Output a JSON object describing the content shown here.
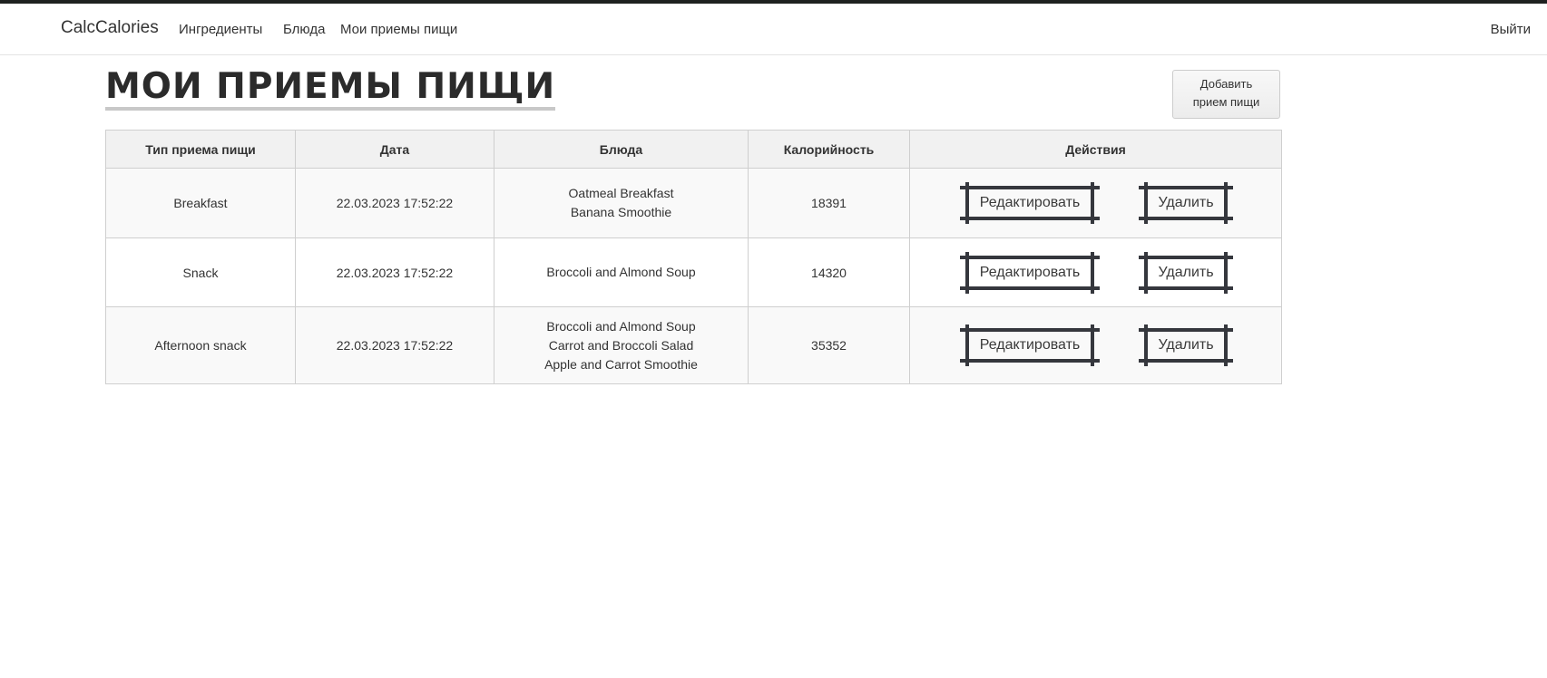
{
  "navbar": {
    "brand": "CalcCalories",
    "links": [
      "Ингредиенты",
      "Блюда",
      "Мои приемы пищи"
    ],
    "logout": "Выйти"
  },
  "page": {
    "title": "МОИ ПРИЕМЫ ПИЩИ",
    "add_button_line1": "Добавить",
    "add_button_line2": "прием пищи"
  },
  "table": {
    "headers": [
      "Тип приема пищи",
      "Дата",
      "Блюда",
      "Калорийность",
      "Действия"
    ],
    "rows": [
      {
        "type": "Breakfast",
        "date": "22.03.2023 17:52:22",
        "dishes": [
          "Oatmeal Breakfast",
          "Banana Smoothie"
        ],
        "calories": "18391",
        "edit": "Редактировать",
        "delete": "Удалить"
      },
      {
        "type": "Snack",
        "date": "22.03.2023 17:52:22",
        "dishes": [
          "Broccoli and Almond Soup"
        ],
        "calories": "14320",
        "edit": "Редактировать",
        "delete": "Удалить"
      },
      {
        "type": "Afternoon snack",
        "date": "22.03.2023 17:52:22",
        "dishes": [
          "Broccoli and Almond Soup",
          "Carrot and Broccoli Salad",
          "Apple and Carrot Smoothie"
        ],
        "calories": "35352",
        "edit": "Редактировать",
        "delete": "Удалить"
      }
    ]
  }
}
